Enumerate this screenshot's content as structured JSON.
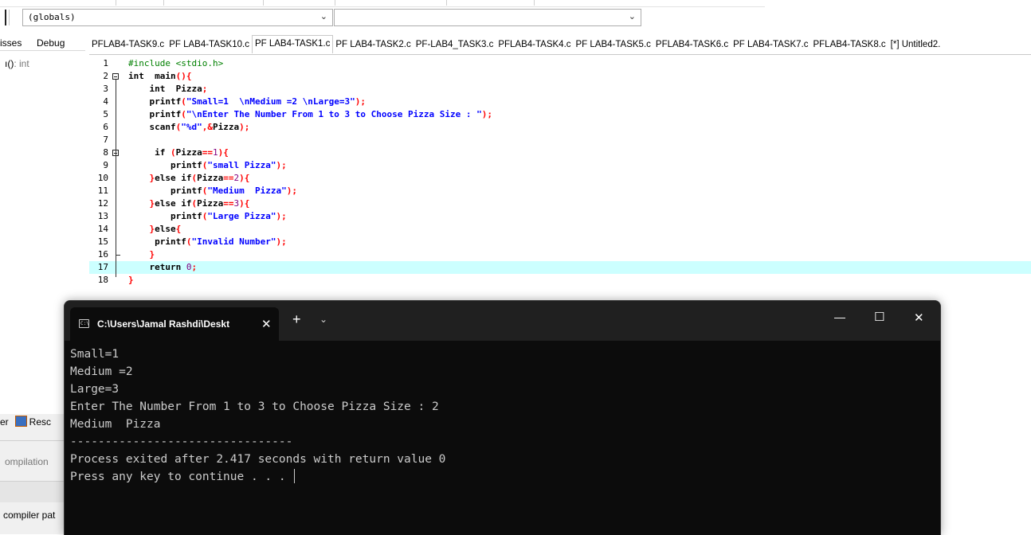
{
  "toolbar": {
    "scope_combo_value": "(globals)",
    "member_combo_value": ""
  },
  "left_panel": {
    "tabs": [
      "isses",
      "Debug"
    ],
    "class_item_name": "ı()",
    "class_item_type": ": int"
  },
  "file_tabs": [
    "PFLAB4-TASK9.c",
    "PF LAB4-TASK10.c",
    "PF LAB4-TASK1.c",
    "PF LAB4-TASK2.c",
    "PF-LAB4_TASK3.c",
    "PFLAB4-TASK4.c",
    "PF LAB4-TASK5.c",
    "PFLAB4-TASK6.c",
    "PF LAB4-TASK7.c",
    "PFLAB4-TASK8.c",
    "[*] Untitled2."
  ],
  "active_file_tab_index": 2,
  "editor": {
    "highlighted_line": 17,
    "lines": [
      {
        "num": "1",
        "html": "<span class=\"pp\">#include &lt;stdio.h&gt;</span>"
      },
      {
        "num": "2",
        "html": "<span class=\"k\">int</span>  <span class=\"k\">main</span><span class=\"p\">(){</span>"
      },
      {
        "num": "3",
        "html": "    <span class=\"k\">int</span>  <span class=\"k\">Pizza</span><span class=\"p\">;</span>"
      },
      {
        "num": "4",
        "html": "    <span class=\"k\">printf</span><span class=\"p\">(</span><span class=\"s\">\"Small=1  \\nMedium =2 \\nLarge=3\"</span><span class=\"p\">);</span>"
      },
      {
        "num": "5",
        "html": "    <span class=\"k\">printf</span><span class=\"p\">(</span><span class=\"s\">\"\\nEnter The Number From 1 to 3 to Choose Pizza Size : \"</span><span class=\"p\">);</span>"
      },
      {
        "num": "6",
        "html": "    <span class=\"k\">scanf</span><span class=\"p\">(</span><span class=\"s\">\"%d\"</span><span class=\"p\">,&amp;</span><span class=\"k\">Pizza</span><span class=\"p\">);</span>"
      },
      {
        "num": "7",
        "html": ""
      },
      {
        "num": "8",
        "html": "     <span class=\"k\">if</span> <span class=\"p\">(</span><span class=\"k\">Pizza</span><span class=\"p\">==</span><span class=\"n\">1</span><span class=\"p\">){</span>"
      },
      {
        "num": "9",
        "html": "        <span class=\"k\">printf</span><span class=\"p\">(</span><span class=\"s\">\"small Pizza\"</span><span class=\"p\">);</span>"
      },
      {
        "num": "10",
        "html": "    <span class=\"p\">}</span><span class=\"k\">else if</span><span class=\"p\">(</span><span class=\"k\">Pizza</span><span class=\"p\">==</span><span class=\"n\">2</span><span class=\"p\">){</span>"
      },
      {
        "num": "11",
        "html": "        <span class=\"k\">printf</span><span class=\"p\">(</span><span class=\"s\">\"Medium  Pizza\"</span><span class=\"p\">);</span>"
      },
      {
        "num": "12",
        "html": "    <span class=\"p\">}</span><span class=\"k\">else if</span><span class=\"p\">(</span><span class=\"k\">Pizza</span><span class=\"p\">==</span><span class=\"n\">3</span><span class=\"p\">){</span>"
      },
      {
        "num": "13",
        "html": "        <span class=\"k\">printf</span><span class=\"p\">(</span><span class=\"s\">\"Large Pizza\"</span><span class=\"p\">);</span>"
      },
      {
        "num": "14",
        "html": "    <span class=\"p\">}</span><span class=\"k\">else</span><span class=\"p\">{</span>"
      },
      {
        "num": "15",
        "html": "     <span class=\"k\">printf</span><span class=\"p\">(</span><span class=\"s\">\"Invalid Number\"</span><span class=\"p\">);</span>"
      },
      {
        "num": "16",
        "html": "    <span class=\"p\">}</span>"
      },
      {
        "num": "17",
        "html": "    <span class=\"k\">return</span> <span class=\"n\">0</span><span class=\"p\">;</span>"
      },
      {
        "num": "18",
        "html": "<span class=\"p\">}</span>"
      }
    ]
  },
  "bottom_panel": {
    "tab_left": "er",
    "tab_label": "Resc",
    "compilation_label": "ompilation",
    "compiler_path_label": "compiler pat"
  },
  "console": {
    "tab_title": "C:\\Users\\Jamal  Rashdi\\Deskt",
    "close_tab_glyph": "✕",
    "new_tab_glyph": "+",
    "dropdown_glyph": "⌄",
    "minimize_glyph": "—",
    "maximize_glyph": "☐",
    "close_glyph": "✕",
    "output_lines": [
      "Small=1",
      "Medium =2",
      "Large=3",
      "Enter The Number From 1 to 3 to Choose Pizza Size : 2",
      "Medium  Pizza",
      "--------------------------------",
      "Process exited after 2.417 seconds with return value 0",
      "Press any key to continue . . . "
    ]
  }
}
